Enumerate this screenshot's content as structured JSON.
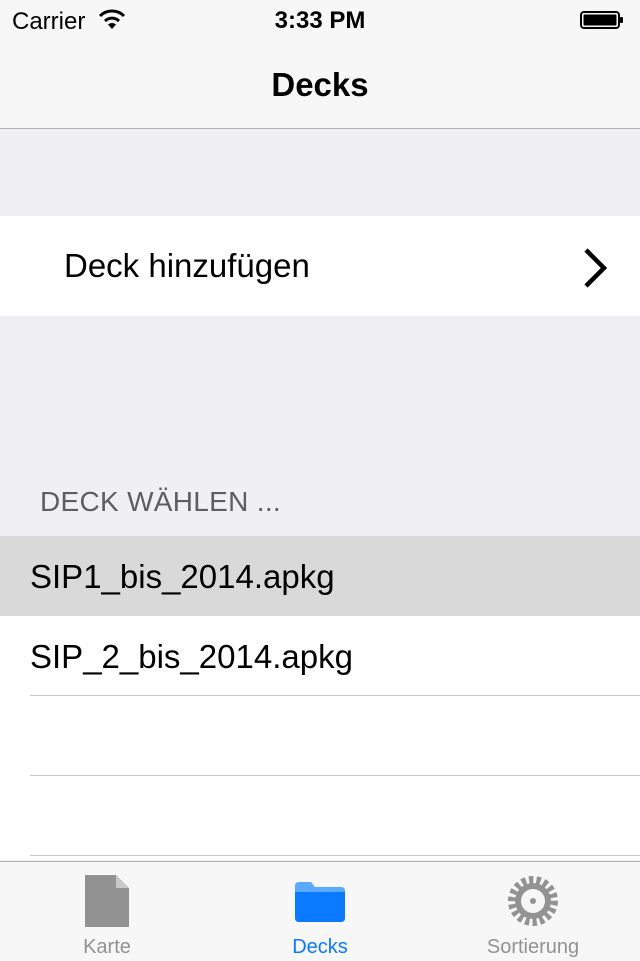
{
  "status_bar": {
    "carrier": "Carrier",
    "time": "3:33 PM"
  },
  "nav": {
    "title": "Decks"
  },
  "add_deck": {
    "label": "Deck hinzufügen"
  },
  "section": {
    "header": "DECK WÄHLEN ..."
  },
  "decks": [
    {
      "name": "SIP1_bis_2014.apkg",
      "selected": true
    },
    {
      "name": "SIP_2_bis_2014.apkg",
      "selected": false
    }
  ],
  "tabs": [
    {
      "label": "Karte",
      "icon": "document-icon",
      "active": false
    },
    {
      "label": "Decks",
      "icon": "folder-icon",
      "active": true
    },
    {
      "label": "Sortierung",
      "icon": "gear-icon",
      "active": false
    }
  ],
  "colors": {
    "accent": "#0a7aff",
    "inactive": "#929292",
    "selected_row": "#d9d9d9"
  }
}
